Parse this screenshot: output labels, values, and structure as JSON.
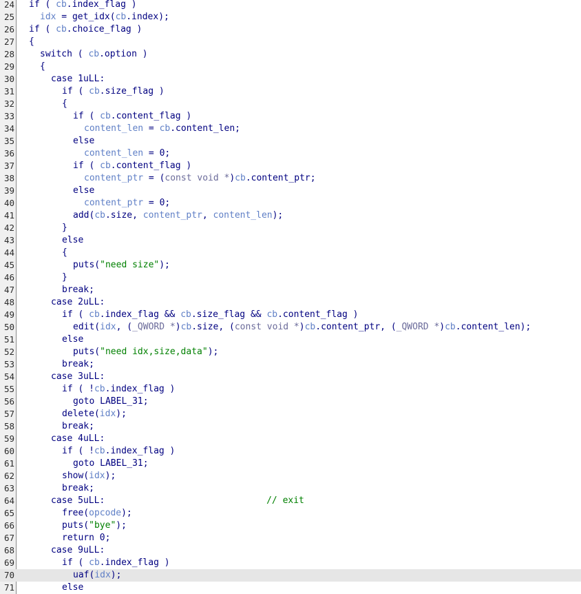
{
  "editor": {
    "current_line": 70,
    "lines": [
      {
        "n": "24",
        "indent": 1,
        "tokens": [
          {
            "t": "if ( ",
            "k": "kw"
          },
          {
            "t": "cb",
            "k": "var"
          },
          {
            "t": ".index_flag )",
            "k": "kw"
          }
        ]
      },
      {
        "n": "25",
        "indent": 2,
        "tokens": [
          {
            "t": "idx",
            "k": "var"
          },
          {
            "t": " = get_idx(",
            "k": "kw"
          },
          {
            "t": "cb",
            "k": "var"
          },
          {
            "t": ".index);",
            "k": "kw"
          }
        ]
      },
      {
        "n": "26",
        "indent": 1,
        "tokens": [
          {
            "t": "if ( ",
            "k": "kw"
          },
          {
            "t": "cb",
            "k": "var"
          },
          {
            "t": ".choice_flag )",
            "k": "kw"
          }
        ]
      },
      {
        "n": "27",
        "indent": 1,
        "tokens": [
          {
            "t": "{",
            "k": "kw"
          }
        ]
      },
      {
        "n": "28",
        "indent": 2,
        "tokens": [
          {
            "t": "switch ( ",
            "k": "kw"
          },
          {
            "t": "cb",
            "k": "var"
          },
          {
            "t": ".option )",
            "k": "kw"
          }
        ]
      },
      {
        "n": "29",
        "indent": 2,
        "tokens": [
          {
            "t": "{",
            "k": "kw"
          }
        ]
      },
      {
        "n": "30",
        "indent": 3,
        "tokens": [
          {
            "t": "case 1uLL:",
            "k": "kw"
          }
        ]
      },
      {
        "n": "31",
        "indent": 4,
        "tokens": [
          {
            "t": "if ( ",
            "k": "kw"
          },
          {
            "t": "cb",
            "k": "var"
          },
          {
            "t": ".size_flag )",
            "k": "kw"
          }
        ]
      },
      {
        "n": "32",
        "indent": 4,
        "tokens": [
          {
            "t": "{",
            "k": "kw"
          }
        ]
      },
      {
        "n": "33",
        "indent": 5,
        "tokens": [
          {
            "t": "if ( ",
            "k": "kw"
          },
          {
            "t": "cb",
            "k": "var"
          },
          {
            "t": ".content_flag )",
            "k": "kw"
          }
        ]
      },
      {
        "n": "34",
        "indent": 6,
        "tokens": [
          {
            "t": "content_len",
            "k": "var"
          },
          {
            "t": " = ",
            "k": "kw"
          },
          {
            "t": "cb",
            "k": "var"
          },
          {
            "t": ".content_len;",
            "k": "kw"
          }
        ]
      },
      {
        "n": "35",
        "indent": 5,
        "tokens": [
          {
            "t": "else",
            "k": "kw"
          }
        ]
      },
      {
        "n": "36",
        "indent": 6,
        "tokens": [
          {
            "t": "content_len",
            "k": "var"
          },
          {
            "t": " = 0;",
            "k": "kw"
          }
        ]
      },
      {
        "n": "37",
        "indent": 5,
        "tokens": [
          {
            "t": "if ( ",
            "k": "kw"
          },
          {
            "t": "cb",
            "k": "var"
          },
          {
            "t": ".content_flag )",
            "k": "kw"
          }
        ]
      },
      {
        "n": "38",
        "indent": 6,
        "tokens": [
          {
            "t": "content_ptr",
            "k": "var"
          },
          {
            "t": " = (",
            "k": "kw"
          },
          {
            "t": "const void *",
            "k": "typ"
          },
          {
            "t": ")",
            "k": "kw"
          },
          {
            "t": "cb",
            "k": "var"
          },
          {
            "t": ".content_ptr;",
            "k": "kw"
          }
        ]
      },
      {
        "n": "39",
        "indent": 5,
        "tokens": [
          {
            "t": "else",
            "k": "kw"
          }
        ]
      },
      {
        "n": "40",
        "indent": 6,
        "tokens": [
          {
            "t": "content_ptr",
            "k": "var"
          },
          {
            "t": " = 0;",
            "k": "kw"
          }
        ]
      },
      {
        "n": "41",
        "indent": 5,
        "tokens": [
          {
            "t": "add(",
            "k": "kw"
          },
          {
            "t": "cb",
            "k": "var"
          },
          {
            "t": ".size, ",
            "k": "kw"
          },
          {
            "t": "content_ptr",
            "k": "var"
          },
          {
            "t": ", ",
            "k": "kw"
          },
          {
            "t": "content_len",
            "k": "var"
          },
          {
            "t": ");",
            "k": "kw"
          }
        ]
      },
      {
        "n": "42",
        "indent": 4,
        "tokens": [
          {
            "t": "}",
            "k": "kw"
          }
        ]
      },
      {
        "n": "43",
        "indent": 4,
        "tokens": [
          {
            "t": "else",
            "k": "kw"
          }
        ]
      },
      {
        "n": "44",
        "indent": 4,
        "tokens": [
          {
            "t": "{",
            "k": "kw"
          }
        ]
      },
      {
        "n": "45",
        "indent": 5,
        "tokens": [
          {
            "t": "puts(",
            "k": "kw"
          },
          {
            "t": "\"need size\"",
            "k": "str"
          },
          {
            "t": ");",
            "k": "kw"
          }
        ]
      },
      {
        "n": "46",
        "indent": 4,
        "tokens": [
          {
            "t": "}",
            "k": "kw"
          }
        ]
      },
      {
        "n": "47",
        "indent": 4,
        "tokens": [
          {
            "t": "break;",
            "k": "kw"
          }
        ]
      },
      {
        "n": "48",
        "indent": 3,
        "tokens": [
          {
            "t": "case 2uLL:",
            "k": "kw"
          }
        ]
      },
      {
        "n": "49",
        "indent": 4,
        "tokens": [
          {
            "t": "if ( ",
            "k": "kw"
          },
          {
            "t": "cb",
            "k": "var"
          },
          {
            "t": ".index_flag && ",
            "k": "kw"
          },
          {
            "t": "cb",
            "k": "var"
          },
          {
            "t": ".size_flag && ",
            "k": "kw"
          },
          {
            "t": "cb",
            "k": "var"
          },
          {
            "t": ".content_flag )",
            "k": "kw"
          }
        ]
      },
      {
        "n": "50",
        "indent": 5,
        "tokens": [
          {
            "t": "edit(",
            "k": "kw"
          },
          {
            "t": "idx",
            "k": "var"
          },
          {
            "t": ", (",
            "k": "kw"
          },
          {
            "t": "_QWORD *",
            "k": "typ"
          },
          {
            "t": ")",
            "k": "kw"
          },
          {
            "t": "cb",
            "k": "var"
          },
          {
            "t": ".size, (",
            "k": "kw"
          },
          {
            "t": "const void *",
            "k": "typ"
          },
          {
            "t": ")",
            "k": "kw"
          },
          {
            "t": "cb",
            "k": "var"
          },
          {
            "t": ".content_ptr, (",
            "k": "kw"
          },
          {
            "t": "_QWORD *",
            "k": "typ"
          },
          {
            "t": ")",
            "k": "kw"
          },
          {
            "t": "cb",
            "k": "var"
          },
          {
            "t": ".content_len);",
            "k": "kw"
          }
        ]
      },
      {
        "n": "51",
        "indent": 4,
        "tokens": [
          {
            "t": "else",
            "k": "kw"
          }
        ]
      },
      {
        "n": "52",
        "indent": 5,
        "tokens": [
          {
            "t": "puts(",
            "k": "kw"
          },
          {
            "t": "\"need idx,size,data\"",
            "k": "str"
          },
          {
            "t": ");",
            "k": "kw"
          }
        ]
      },
      {
        "n": "53",
        "indent": 4,
        "tokens": [
          {
            "t": "break;",
            "k": "kw"
          }
        ]
      },
      {
        "n": "54",
        "indent": 3,
        "tokens": [
          {
            "t": "case 3uLL:",
            "k": "kw"
          }
        ]
      },
      {
        "n": "55",
        "indent": 4,
        "tokens": [
          {
            "t": "if ( !",
            "k": "kw"
          },
          {
            "t": "cb",
            "k": "var"
          },
          {
            "t": ".index_flag )",
            "k": "kw"
          }
        ]
      },
      {
        "n": "56",
        "indent": 5,
        "tokens": [
          {
            "t": "goto LABEL_31;",
            "k": "kw"
          }
        ]
      },
      {
        "n": "57",
        "indent": 4,
        "tokens": [
          {
            "t": "delete(",
            "k": "kw"
          },
          {
            "t": "idx",
            "k": "var"
          },
          {
            "t": ");",
            "k": "kw"
          }
        ]
      },
      {
        "n": "58",
        "indent": 4,
        "tokens": [
          {
            "t": "break;",
            "k": "kw"
          }
        ]
      },
      {
        "n": "59",
        "indent": 3,
        "tokens": [
          {
            "t": "case 4uLL:",
            "k": "kw"
          }
        ]
      },
      {
        "n": "60",
        "indent": 4,
        "tokens": [
          {
            "t": "if ( !",
            "k": "kw"
          },
          {
            "t": "cb",
            "k": "var"
          },
          {
            "t": ".index_flag )",
            "k": "kw"
          }
        ]
      },
      {
        "n": "61",
        "indent": 5,
        "tokens": [
          {
            "t": "goto LABEL_31;",
            "k": "kw"
          }
        ]
      },
      {
        "n": "62",
        "indent": 4,
        "tokens": [
          {
            "t": "show(",
            "k": "kw"
          },
          {
            "t": "idx",
            "k": "var"
          },
          {
            "t": ");",
            "k": "kw"
          }
        ]
      },
      {
        "n": "63",
        "indent": 4,
        "tokens": [
          {
            "t": "break;",
            "k": "kw"
          }
        ]
      },
      {
        "n": "64",
        "indent": 3,
        "tokens": [
          {
            "t": "case 5uLL:",
            "k": "kw"
          },
          {
            "t": "                              ",
            "k": "kw"
          },
          {
            "t": "// exit",
            "k": "cmt"
          }
        ]
      },
      {
        "n": "65",
        "indent": 4,
        "tokens": [
          {
            "t": "free(",
            "k": "kw"
          },
          {
            "t": "opcode",
            "k": "var"
          },
          {
            "t": ");",
            "k": "kw"
          }
        ]
      },
      {
        "n": "66",
        "indent": 4,
        "tokens": [
          {
            "t": "puts(",
            "k": "kw"
          },
          {
            "t": "\"bye\"",
            "k": "str"
          },
          {
            "t": ");",
            "k": "kw"
          }
        ]
      },
      {
        "n": "67",
        "indent": 4,
        "tokens": [
          {
            "t": "return 0;",
            "k": "kw"
          }
        ]
      },
      {
        "n": "68",
        "indent": 3,
        "tokens": [
          {
            "t": "case 9uLL:",
            "k": "kw"
          }
        ]
      },
      {
        "n": "69",
        "indent": 4,
        "tokens": [
          {
            "t": "if ( ",
            "k": "kw"
          },
          {
            "t": "cb",
            "k": "var"
          },
          {
            "t": ".index_flag )",
            "k": "kw"
          }
        ]
      },
      {
        "n": "70",
        "indent": 5,
        "tokens": [
          {
            "t": "uaf(",
            "k": "kw"
          },
          {
            "t": "idx",
            "k": "var"
          },
          {
            "t": ");",
            "k": "kw"
          }
        ]
      },
      {
        "n": "71",
        "indent": 4,
        "tokens": [
          {
            "t": "else",
            "k": "kw"
          }
        ]
      }
    ]
  }
}
